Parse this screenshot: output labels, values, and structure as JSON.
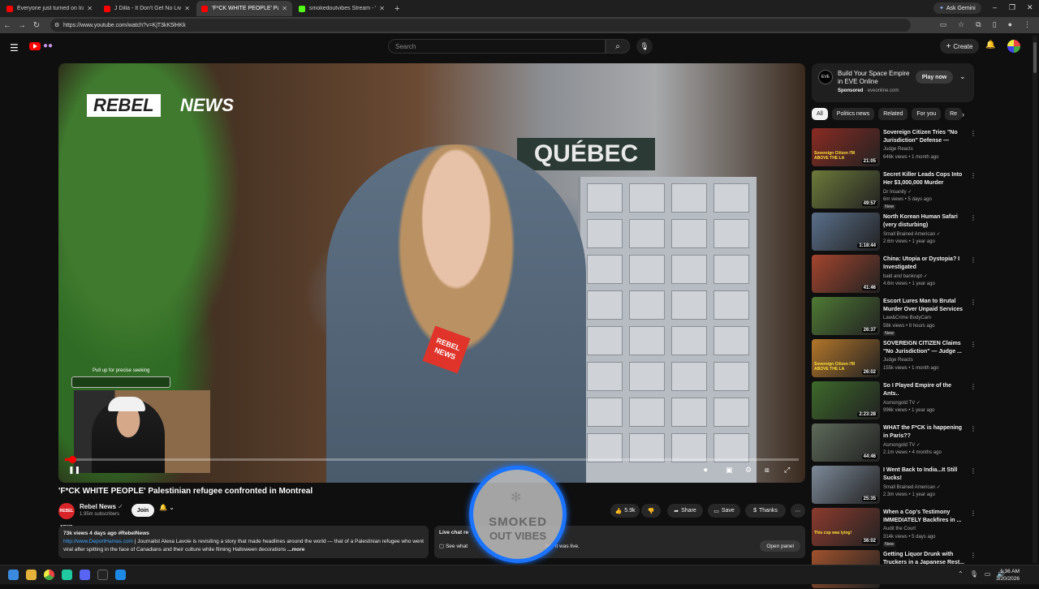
{
  "browser": {
    "tabs": [
      {
        "title": "Everyone just turned on Iran.",
        "active": false,
        "icon": "youtube"
      },
      {
        "title": "J Dilla - It Don't Get No Liver Th",
        "active": false,
        "icon": "youtube"
      },
      {
        "title": "'F*CK WHITE PEOPLE' Palest",
        "active": true,
        "icon": "youtube"
      },
      {
        "title": "smokedoutvibes Stream - Watch",
        "active": false,
        "icon": "kick"
      }
    ],
    "ask_gemini": "Ask Gemini",
    "url": "https://www.youtube.com/watch?v=KjT3kK5lHKk"
  },
  "yt": {
    "search_placeholder": "Search",
    "create_label": "Create"
  },
  "video": {
    "watermark_left": "REBEL",
    "watermark_right": "NEWS",
    "sign_text": "QUÉBEC",
    "mic_flag": "REBEL NEWS",
    "seek_hint": "Pull up for precise seeking",
    "progress_fraction": 0.01
  },
  "info": {
    "title": "'F*CK WHITE PEOPLE' Palestinian refugee confronted in Montreal",
    "channel_name": "Rebel News",
    "channel_avatar": "REBEL NEWS",
    "subscribers": "1.95m subscribers",
    "join_label": "Join",
    "likes": "5.9k",
    "share_label": "Share",
    "save_label": "Save",
    "thanks_label": "Thanks",
    "desc_stats": "73k views  4 days ago  #RebelNews",
    "desc_link": "http://www.DeportHamas.com",
    "desc_text": " | Journalist Alexa Lavoie is revisiting a story that made headlines around the world — that of a Palestinian refugee who went viral after spitting in the face of Canadians and their culture while filming Halloween decorations",
    "desc_more": " ...more",
    "livechat_title": "Live chat re",
    "livechat_text": "See what",
    "livechat_tail": "hile it was live.",
    "open_panel": "Open panel"
  },
  "overlay": {
    "line1": "SMOKED",
    "line2": "OUT VIBES"
  },
  "ad": {
    "logo": "EVE",
    "title": "Build Your Space Empire in EVE Online",
    "sponsored": "Sponsored",
    "domain": "eveonline.com",
    "cta": "Play now"
  },
  "chips": [
    "All",
    "Politics news",
    "Related",
    "For you",
    "Re"
  ],
  "recs": [
    {
      "title": "Sovereign Citizen Tries \"No Jurisdiction\" Defense  — Judg...",
      "channel": "Judge Reacts",
      "meta": "646k views • 1 month ago",
      "duration": "21:05",
      "new": "",
      "verified": false,
      "thumb": "#8a2b22",
      "thumb_text": "Sovereign Citizen I'M ABOVE THE LA"
    },
    {
      "title": "Secret Killer Leads Cops Into Her $3,000,000 Murder Mansion",
      "channel": "Dr Insanity",
      "meta": "6m views • 5 days ago",
      "duration": "49:57",
      "new": "New",
      "verified": true,
      "thumb": "#6d7a3a",
      "thumb_text": ""
    },
    {
      "title": "North Korean Human Safari (very disturbing)",
      "channel": "Small Brained American",
      "meta": "2.6m views • 1 year ago",
      "duration": "1:18:44",
      "new": "",
      "verified": true,
      "thumb": "#5a6f8a",
      "thumb_text": ""
    },
    {
      "title": "China: Utopia or Dystopia? I Investigated",
      "channel": "bald and bankrupt",
      "meta": "4.6m views • 1 year ago",
      "duration": "41:46",
      "new": "",
      "verified": true,
      "thumb": "#a4452e",
      "thumb_text": ""
    },
    {
      "title": "Escort Lures Man to Brutal Murder Over Unpaid Services",
      "channel": "Law&Crime BodyCam",
      "meta": "58k views • 8 hours ago",
      "duration": "26:37",
      "new": "New",
      "verified": false,
      "thumb": "#4f7a34",
      "thumb_text": ""
    },
    {
      "title": "SOVEREIGN CITIZEN Claims \"No Jurisdiction\" — Judge ...",
      "channel": "Judge Reacts",
      "meta": "155k views • 1 month ago",
      "duration": "26:02",
      "new": "",
      "verified": false,
      "thumb": "#b3762a",
      "thumb_text": "Sovereign Citizen I'M ABOVE THE LA"
    },
    {
      "title": "So I Played Empire of the Ants..",
      "channel": "Asmongold TV",
      "meta": "996k views • 1 year ago",
      "duration": "2:23:28",
      "new": "",
      "verified": true,
      "thumb": "#3d6a2a",
      "thumb_text": ""
    },
    {
      "title": "WHAT the F*CK is happening in Paris??",
      "channel": "Asmongold TV",
      "meta": "2.1m views • 4 months ago",
      "duration": "44:46",
      "new": "",
      "verified": true,
      "thumb": "#5e6a5a",
      "thumb_text": ""
    },
    {
      "title": "I Went Back to India...It Still Sucks!",
      "channel": "Small Brained American",
      "meta": "2.3m views • 1 year ago",
      "duration": "25:35",
      "new": "",
      "verified": true,
      "thumb": "#7d8a99",
      "thumb_text": ""
    },
    {
      "title": "When a Cop's Testimony IMMEDIATELY Backfires in ...",
      "channel": "Audit the Court",
      "meta": "314k views • 5 days ago",
      "duration": "36:02",
      "new": "New",
      "verified": false,
      "thumb": "#8c3b2e",
      "thumb_text": "This cop was lying!"
    },
    {
      "title": "Getting Liquor Drunk with Truckers in a Japanese Rest...",
      "channel": "",
      "meta": "",
      "duration": "",
      "new": "",
      "verified": false,
      "thumb": "#a0522d",
      "thumb_text": ""
    }
  ],
  "taskbar": {
    "time": "1:36 AM",
    "date": "3/20/2026"
  }
}
